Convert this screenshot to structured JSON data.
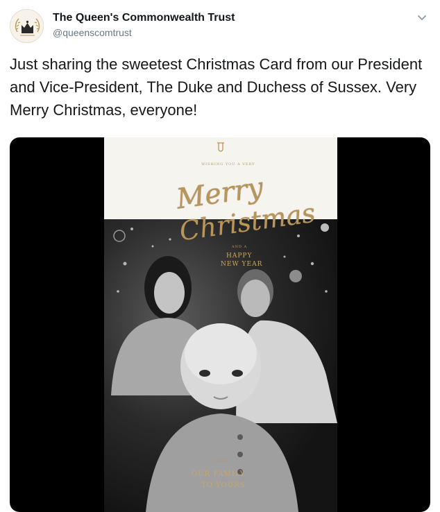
{
  "author": {
    "name": "The Queen's Commonwealth Trust",
    "handle": "@queenscomtrust"
  },
  "tweet": {
    "text": "Just sharing the sweetest Christmas Card from our President and Vice-President, The Duke and Duchess of Sussex. Very Merry Christmas, everyone!"
  },
  "icons": {
    "avatar": "crown-logo",
    "menu": "chevron-down-icon",
    "card_monogram": "crest-icon"
  },
  "card": {
    "greeting_small": "WISHING YOU A VERY",
    "merry": "Merry",
    "christmas": "Christmas",
    "and_a": "AND A",
    "happy": "HAPPY",
    "new_year": "NEW YEAR",
    "from": "FROM",
    "our_family": "OUR FAMILY",
    "to_yours": "TO YOURS"
  },
  "colors": {
    "text_primary": "#14171a",
    "text_secondary": "#657786",
    "gold": "#b8955a",
    "media_bg": "#000000"
  }
}
